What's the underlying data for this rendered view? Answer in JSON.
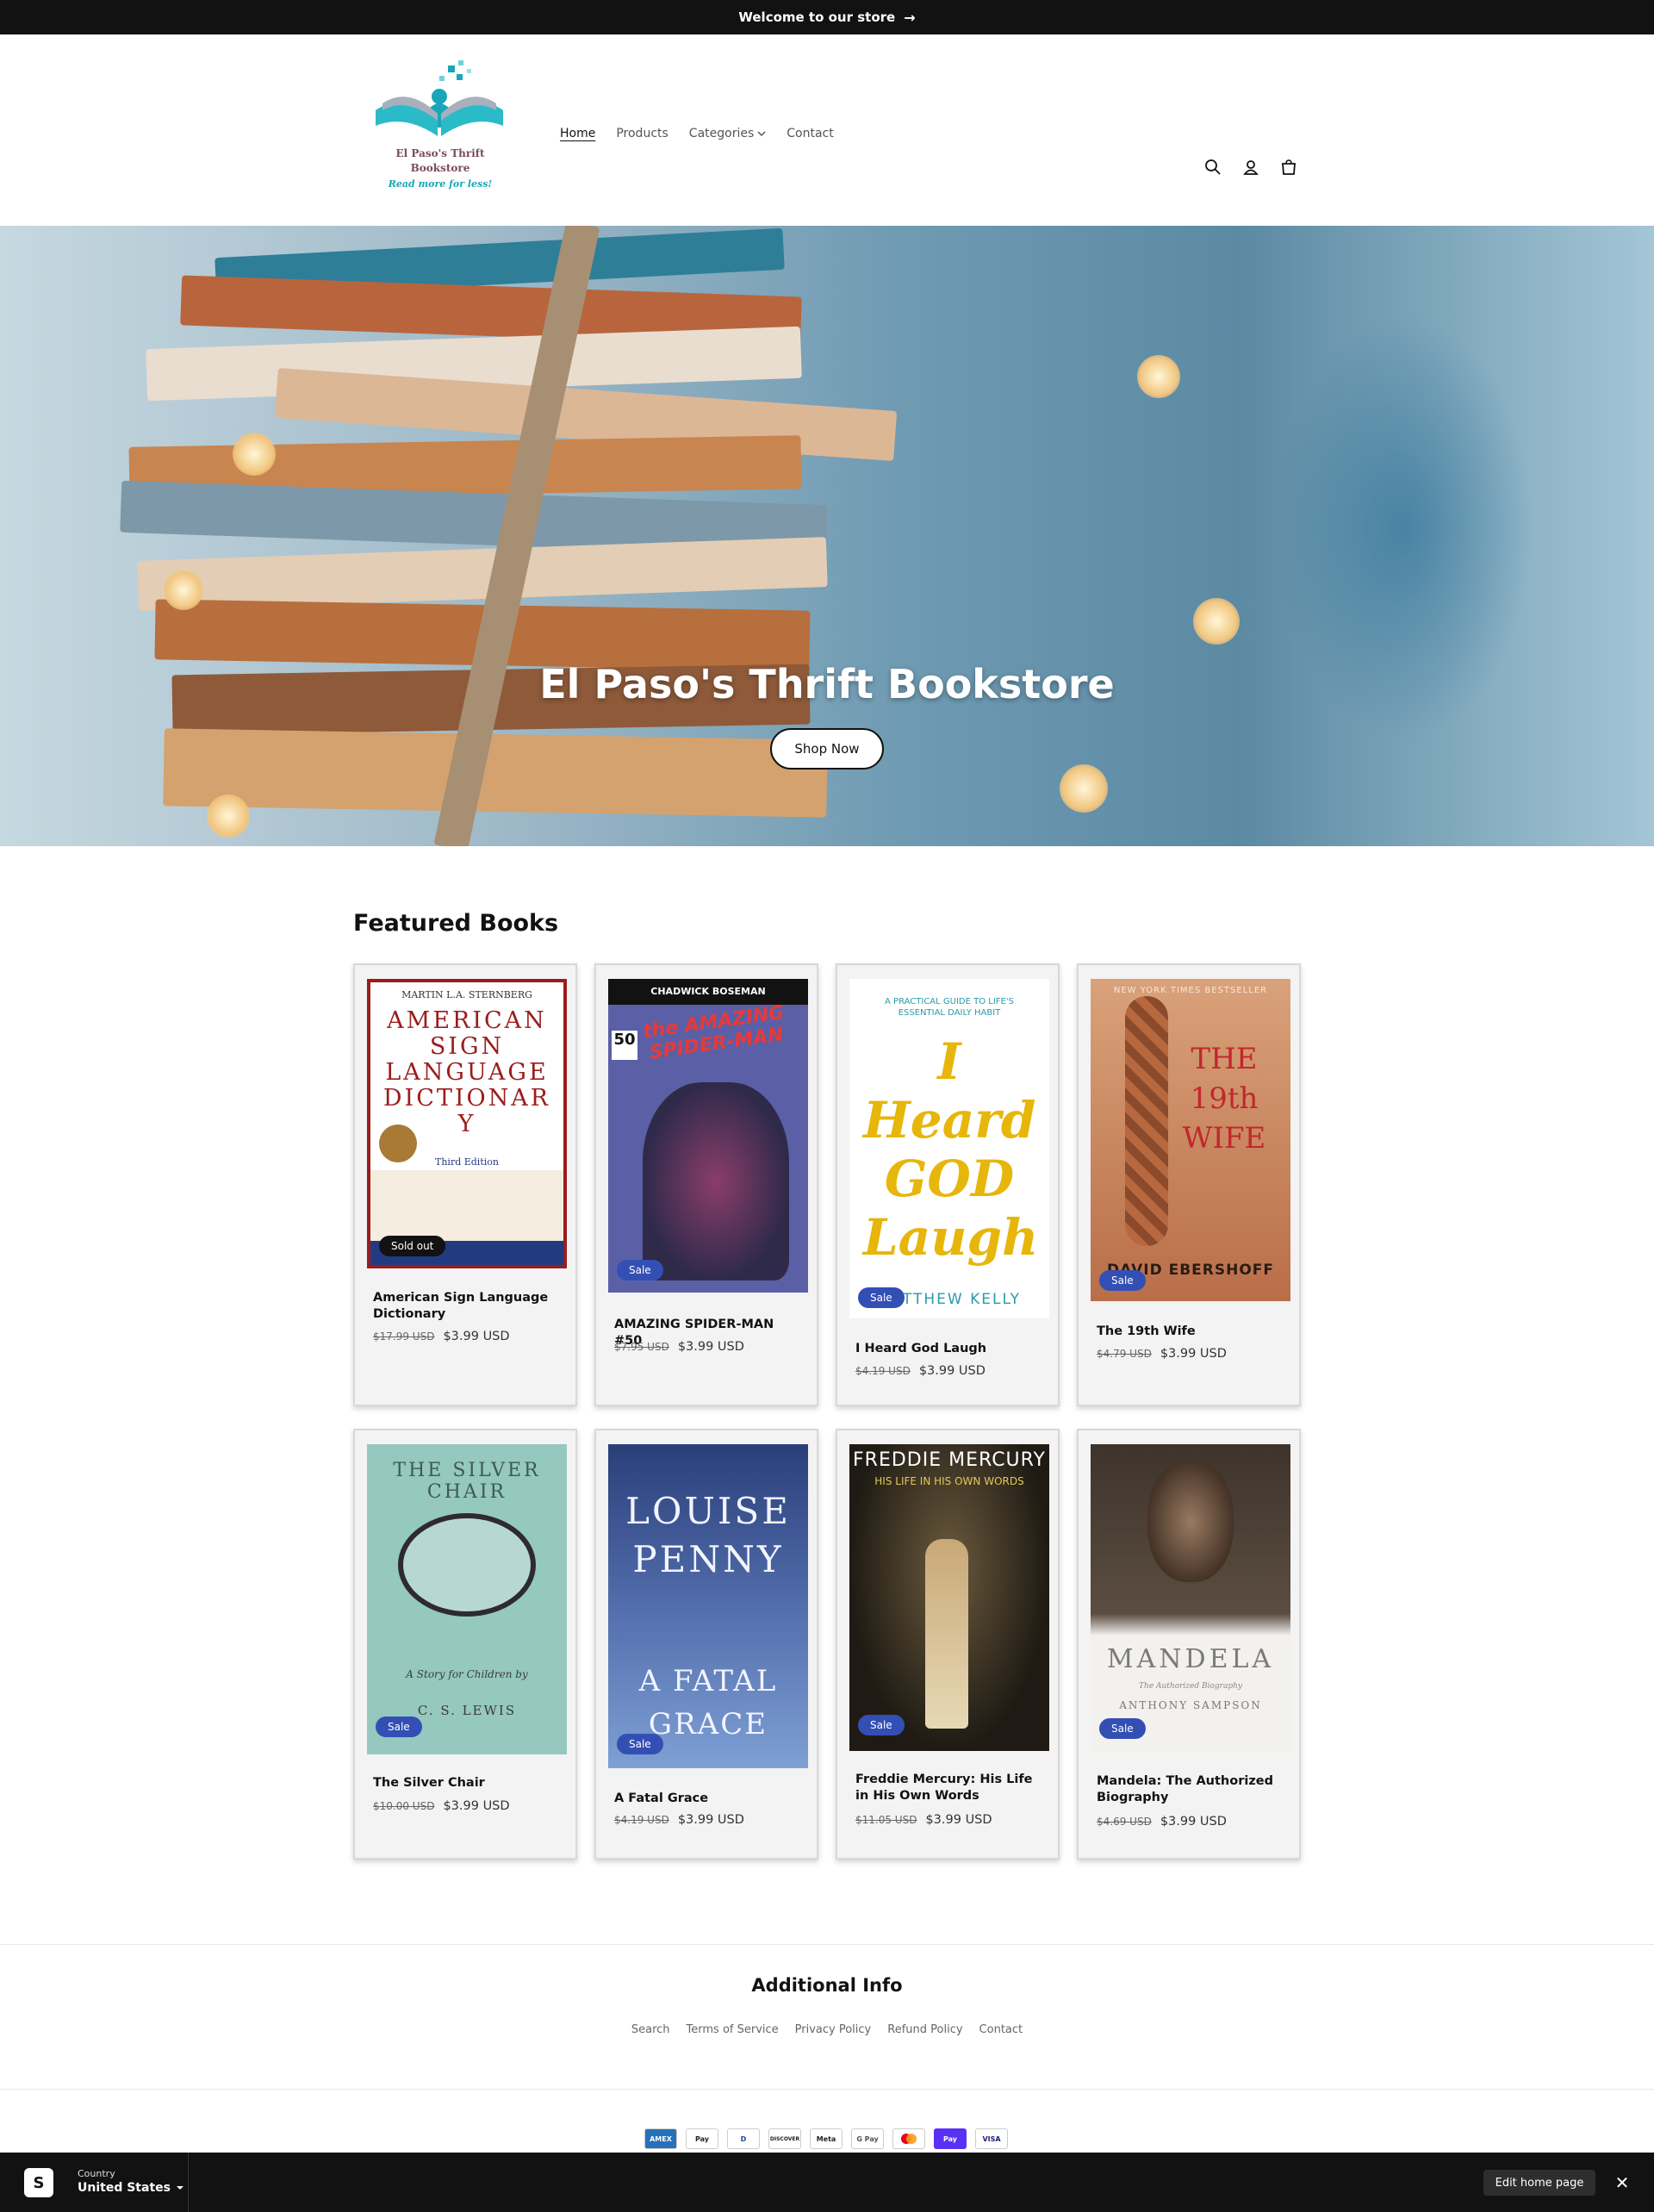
{
  "announcement": {
    "text": "Welcome to our store",
    "arrow": "→"
  },
  "logo": {
    "line1": "El Paso's Thrift",
    "line2": "Bookstore",
    "tagline": "Read more for less!"
  },
  "nav": {
    "home": "Home",
    "products": "Products",
    "categories": "Categories",
    "contact": "Contact"
  },
  "hero": {
    "title": "El Paso's Thrift Bookstore",
    "button": "Shop Now"
  },
  "featured": {
    "title": "Featured Books",
    "products": [
      {
        "title": "American Sign Language Dictionary",
        "old_price": "$17.99 USD",
        "price": "$3.99 USD",
        "badge": "Sold out",
        "cover": {
          "author": "MARTIN L.A. STERNBERG",
          "title": "AMERICAN SIGN LANGUAGE DICTIONARY",
          "edition": "Third Edition"
        }
      },
      {
        "title": "AMAZING SPIDER-MAN #50",
        "old_price": "$7.95 USD",
        "price": "$3.99 USD",
        "badge": "Sale",
        "cover": {
          "top": "CHADWICK BOSEMAN",
          "title": "the AMAZING SPIDER-MAN",
          "issue": "50"
        }
      },
      {
        "title": "I Heard God Laugh",
        "old_price": "$4.19 USD",
        "price": "$3.99 USD",
        "badge": "Sale",
        "cover": {
          "top": "A PRACTICAL GUIDE TO LIFE'S ESSENTIAL DAILY HABIT",
          "title": "I Heard GOD Laugh",
          "author": "MATTHEW KELLY"
        }
      },
      {
        "title": "The 19th Wife",
        "old_price": "$4.79 USD",
        "price": "$3.99 USD",
        "badge": "Sale",
        "cover": {
          "top": "NEW YORK TIMES BESTSELLER",
          "title": "THE 19th WIFE",
          "author": "DAVID EBERSHOFF"
        }
      },
      {
        "title": "The Silver Chair",
        "old_price": "$10.00 USD",
        "price": "$3.99 USD",
        "badge": "Sale",
        "cover": {
          "title": "THE SILVER CHAIR",
          "sub": "A Story for Children by",
          "author": "C. S. LEWIS"
        }
      },
      {
        "title": "A Fatal Grace",
        "old_price": "$4.19 USD",
        "price": "$3.99 USD",
        "badge": "Sale",
        "cover": {
          "author": "LOUISE PENNY",
          "title": "A FATAL GRACE"
        }
      },
      {
        "title": "Freddie Mercury: His Life in His Own Words",
        "old_price": "$11.05 USD",
        "price": "$3.99 USD",
        "badge": "Sale",
        "cover": {
          "title": "FREDDIE MERCURY",
          "sub": "HIS LIFE IN HIS OWN WORDS"
        }
      },
      {
        "title": "Mandela: The Authorized Biography",
        "old_price": "$4.69 USD",
        "price": "$3.99 USD",
        "badge": "Sale",
        "cover": {
          "title": "MANDELA",
          "sub": "The Authorized Biography",
          "author": "ANTHONY SAMPSON"
        }
      }
    ]
  },
  "footer": {
    "heading": "Additional Info",
    "links": [
      "Search",
      "Terms of Service",
      "Privacy Policy",
      "Refund Policy",
      "Contact"
    ],
    "payments": [
      "AMEX",
      "Pay",
      "D",
      "DISCOVER",
      "Meta",
      "G Pay",
      "MC",
      "Pay",
      "VISA"
    ]
  },
  "admin_bar": {
    "country_label": "Country",
    "country_value": "United States",
    "edit_button": "Edit home page",
    "close": "✕",
    "shopify_icon": "shopify-bag-icon"
  },
  "colors": {
    "sale_badge": "#334fb4",
    "dark": "#121212",
    "accent_teal": "#1aa6b7"
  }
}
